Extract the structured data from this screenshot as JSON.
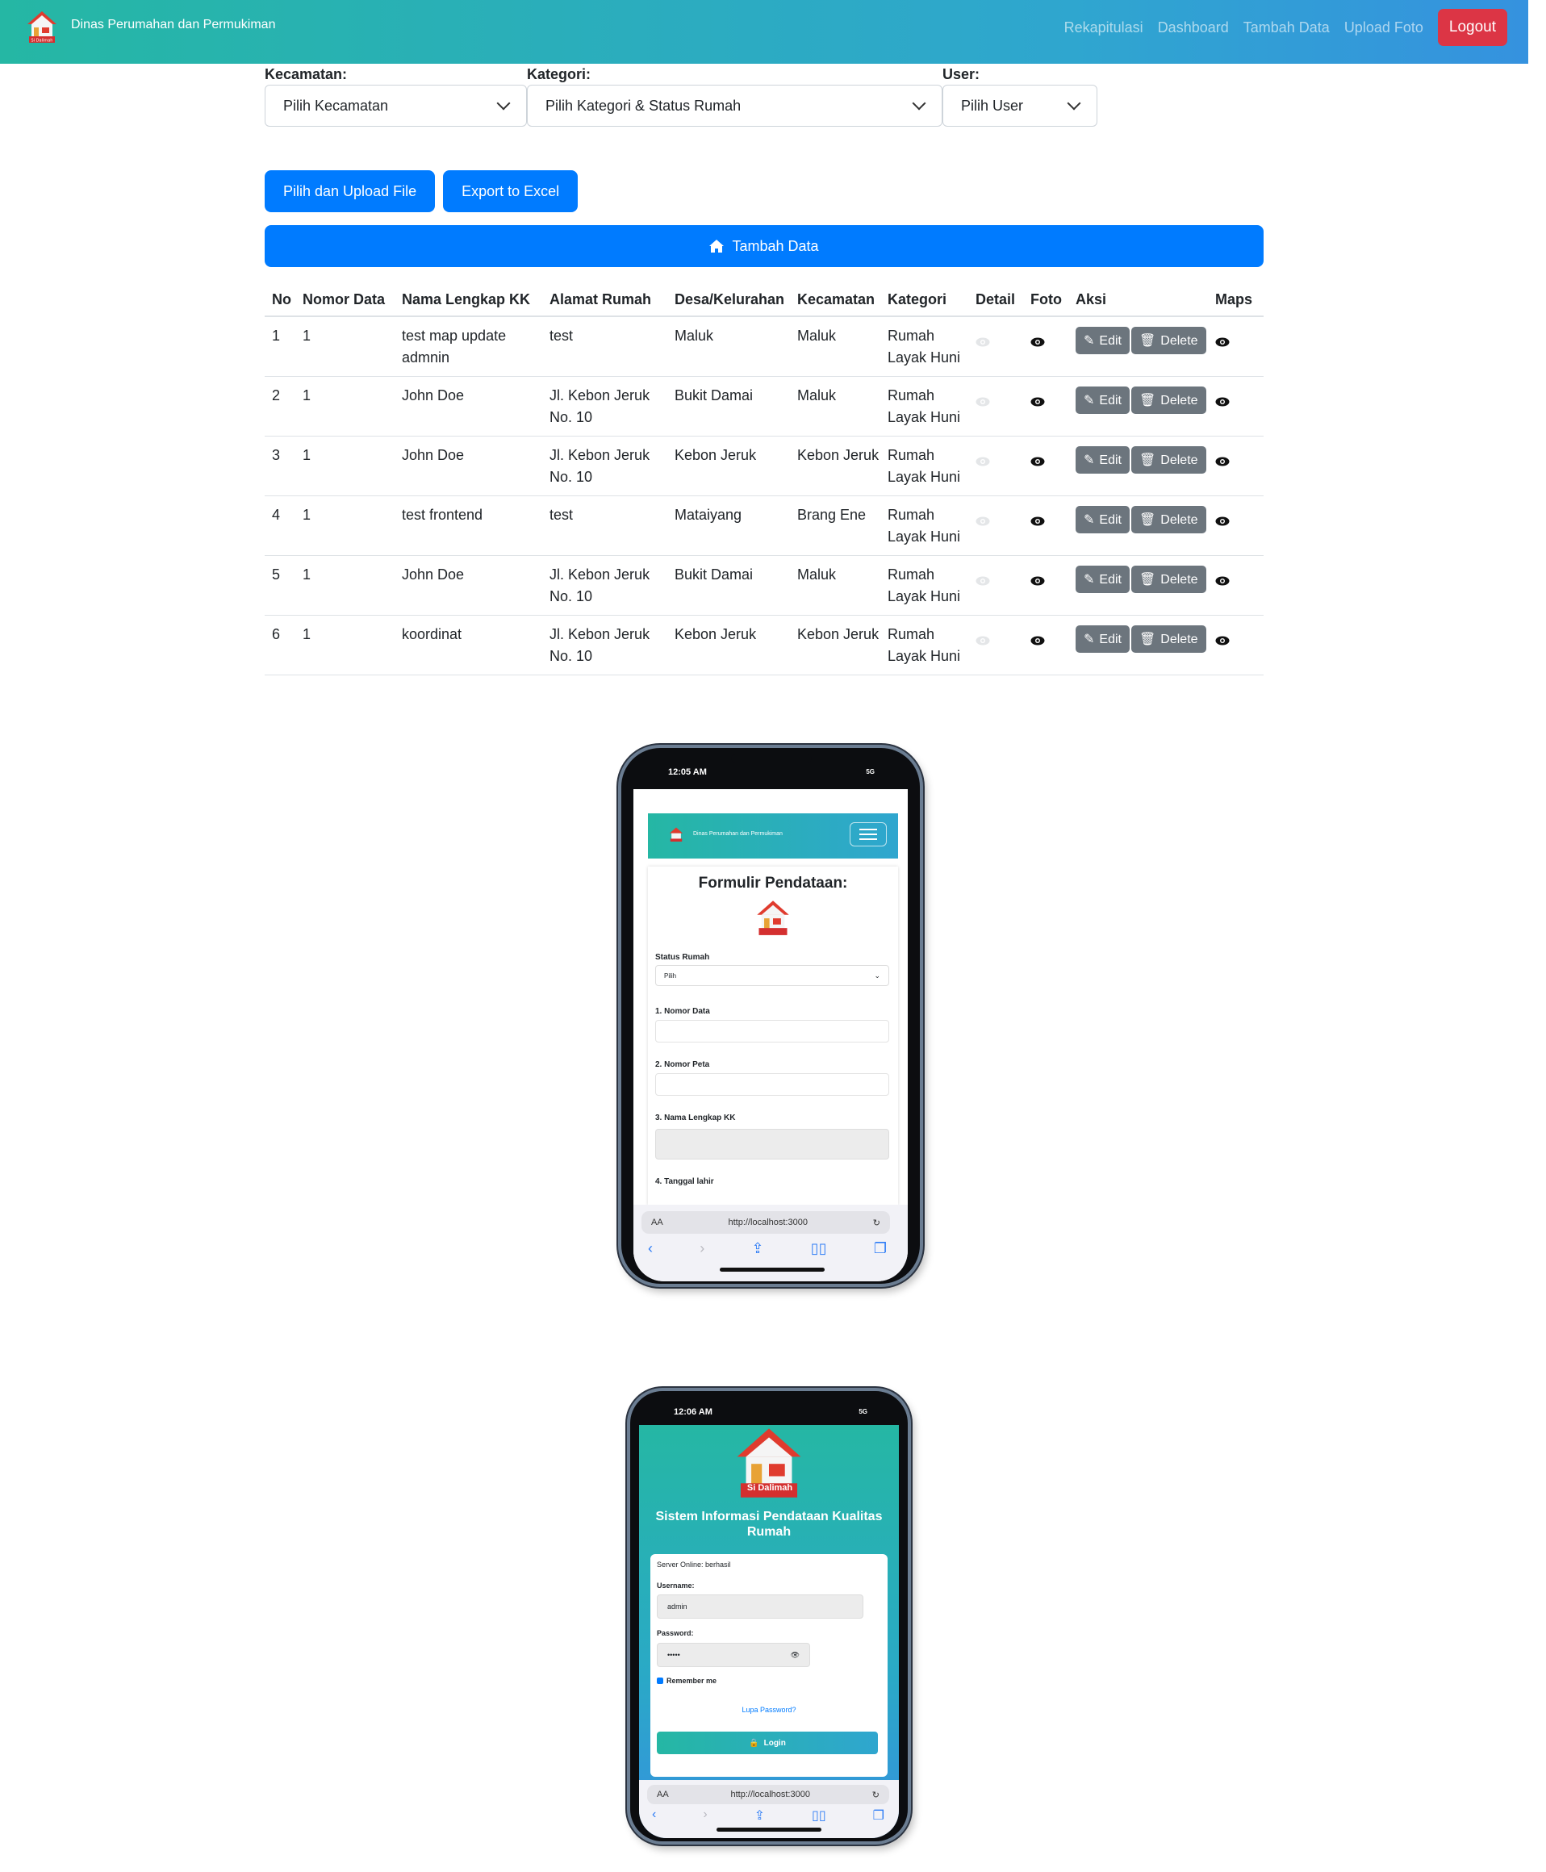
{
  "app": {
    "brand": "Dinas Perumahan dan Permukiman",
    "logo_text": "Si Dalimah"
  },
  "nav": {
    "links": [
      "Rekapitulasi",
      "Dashboard",
      "Tambah Data",
      "Upload Foto"
    ],
    "logout": "Logout"
  },
  "filters": {
    "kecamatan": {
      "label": "Kecamatan:",
      "value": "Pilih Kecamatan"
    },
    "kategori": {
      "label": "Kategori:",
      "value": "Pilih Kategori & Status Rumah"
    },
    "user": {
      "label": "User:",
      "value": "Pilih User"
    }
  },
  "buttons": {
    "upload": "Pilih dan Upload File",
    "export": "Export to Excel",
    "tambah": "Tambah Data"
  },
  "table": {
    "headers": [
      "No",
      "Nomor Data",
      "Nama Lengkap KK",
      "Alamat Rumah",
      "Desa/Kelurahan",
      "Kecamatan",
      "Kategori",
      "Detail",
      "Foto",
      "Aksi",
      "Maps"
    ],
    "edit_label": "Edit",
    "delete_label": "Delete",
    "rows": [
      {
        "no": "1",
        "nomor": "1",
        "nama": "test map update admnin",
        "alamat": "test",
        "desa": "Maluk",
        "kec": "Maluk",
        "kategori": "Rumah Layak Huni"
      },
      {
        "no": "2",
        "nomor": "1",
        "nama": "John Doe",
        "alamat": "Jl. Kebon Jeruk No. 10",
        "desa": "Bukit Damai",
        "kec": "Maluk",
        "kategori": "Rumah Layak Huni"
      },
      {
        "no": "3",
        "nomor": "1",
        "nama": "John Doe",
        "alamat": "Jl. Kebon Jeruk No. 10",
        "desa": "Kebon Jeruk",
        "kec": "Kebon Jeruk",
        "kategori": "Rumah Layak Huni"
      },
      {
        "no": "4",
        "nomor": "1",
        "nama": "test frontend",
        "alamat": "test",
        "desa": "Mataiyang",
        "kec": "Brang Ene",
        "kategori": "Rumah Layak Huni"
      },
      {
        "no": "5",
        "nomor": "1",
        "nama": "John Doe",
        "alamat": "Jl. Kebon Jeruk No. 10",
        "desa": "Bukit Damai",
        "kec": "Maluk",
        "kategori": "Rumah Layak Huni"
      },
      {
        "no": "6",
        "nomor": "1",
        "nama": "koordinat",
        "alamat": "Jl. Kebon Jeruk No. 10",
        "desa": "Kebon Jeruk",
        "kec": "Kebon Jeruk",
        "kategori": "Rumah Layak Huni"
      }
    ]
  },
  "phone1": {
    "time": "12:05 AM",
    "signal": "5G",
    "brand": "Dinas Perumahan dan Permukiman",
    "form_title": "Formulir Pendataan:",
    "status_label": "Status Rumah",
    "status_value": "Pilih",
    "fields": [
      "1. Nomor Data",
      "2. Nomor Peta",
      "3. Nama Lengkap KK"
    ],
    "next_field": "4. Tanggal lahir",
    "url": "http://localhost:3000",
    "aa": "AA"
  },
  "phone2": {
    "time": "12:06 AM",
    "signal": "5G",
    "title": "Sistem Informasi Pendataan Kualitas Rumah",
    "server": "Server Online: berhasil",
    "username_label": "Username:",
    "username_value": "admin",
    "password_label": "Password:",
    "password_value": "•••••",
    "remember": "Remember me",
    "forgot": "Lupa Password?",
    "login": "Login",
    "url": "http://localhost:3000",
    "aa": "AA"
  },
  "colors": {
    "primary": "#007bff",
    "danger": "#dc3545",
    "secondary": "#6c757d",
    "nav_start": "#25b7a4",
    "nav_end": "#3592df"
  }
}
